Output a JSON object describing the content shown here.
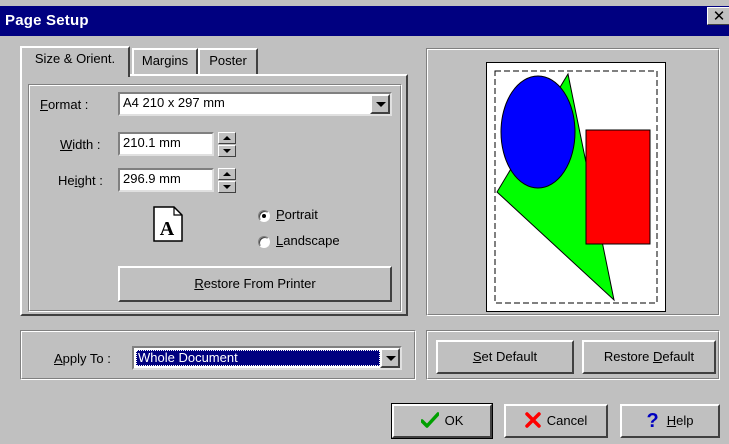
{
  "dialog": {
    "title": "Page Setup",
    "close_label": "✕"
  },
  "tabs": [
    {
      "label": "Size & Orient.",
      "active": true
    },
    {
      "label": "Margins",
      "active": false
    },
    {
      "label": "Poster",
      "active": false
    }
  ],
  "format": {
    "label_pre": "",
    "label_u": "F",
    "label_post": "ormat :",
    "value": "A4 210 x 297 mm"
  },
  "width": {
    "label_pre": "",
    "label_u": "W",
    "label_post": "idth :",
    "value": "210.1 mm"
  },
  "height": {
    "label_pre": "He",
    "label_u": "i",
    "label_post": "ght :",
    "value": "296.9 mm"
  },
  "orientation": {
    "icon_letter": "A",
    "portrait": {
      "label_u": "P",
      "label_rest": "ortrait",
      "checked": true
    },
    "landscape": {
      "label_u": "L",
      "label_rest": "andscape",
      "checked": false
    }
  },
  "restore_from_printer": {
    "label_u": "R",
    "label_rest": "estore From Printer"
  },
  "apply_to": {
    "label_u": "A",
    "label_rest": "pply To :",
    "value": "Whole Document"
  },
  "set_default": {
    "label_u": "S",
    "label_rest": "et Default"
  },
  "restore_default": {
    "label_pre": "Restore ",
    "label_u": "D",
    "label_rest": "efault"
  },
  "ok": {
    "label": "OK"
  },
  "cancel": {
    "label": "Cancel"
  },
  "help": {
    "label_u": "H",
    "label_rest": "elp"
  },
  "colors": {
    "titlebar": "#000080",
    "face": "#c0c0c0",
    "preview_circle": "#0000ff",
    "preview_triangle": "#00ff00",
    "preview_rect": "#ff0000",
    "ok_check": "#00a000",
    "cancel_x": "#ff0000",
    "help_q": "#0000c0"
  }
}
